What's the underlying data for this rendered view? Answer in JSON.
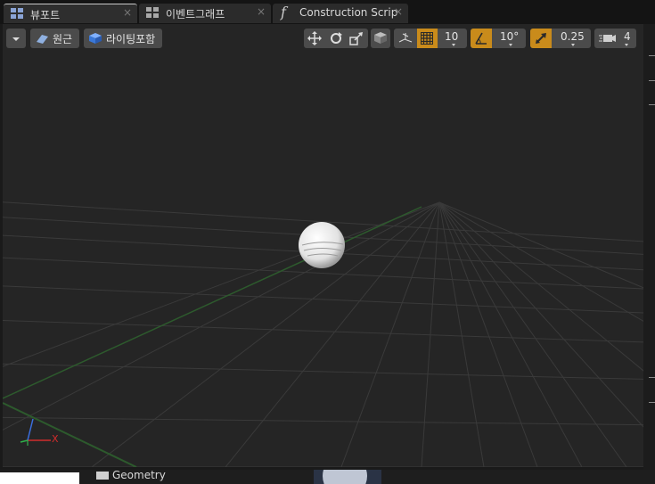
{
  "tabs": [
    {
      "label": "뷰포트",
      "icon": "viewport-grid-icon",
      "close": "×"
    },
    {
      "label": "이벤트그래프",
      "icon": "event-graph-icon",
      "close": "×"
    },
    {
      "label": "Construction Scrip",
      "icon": "function-icon",
      "glyph": "f",
      "close": "×"
    }
  ],
  "toolbar": {
    "perspective_label": "원근",
    "lit_label": "라이팅포함",
    "grid_snap_value": "10",
    "rotation_snap_value": "10°",
    "scale_snap_value": "0.25",
    "camera_speed_value": "4"
  },
  "axes": {
    "x_label": "X"
  },
  "outliner": {
    "geometry_label": "Geometry"
  },
  "colors": {
    "accent_orange": "#c98b1b",
    "grid_line": "#3a3a3a",
    "x_axis": "#d22c2c",
    "y_axis": "#2fb14a",
    "z_axis": "#3b6fe0"
  }
}
